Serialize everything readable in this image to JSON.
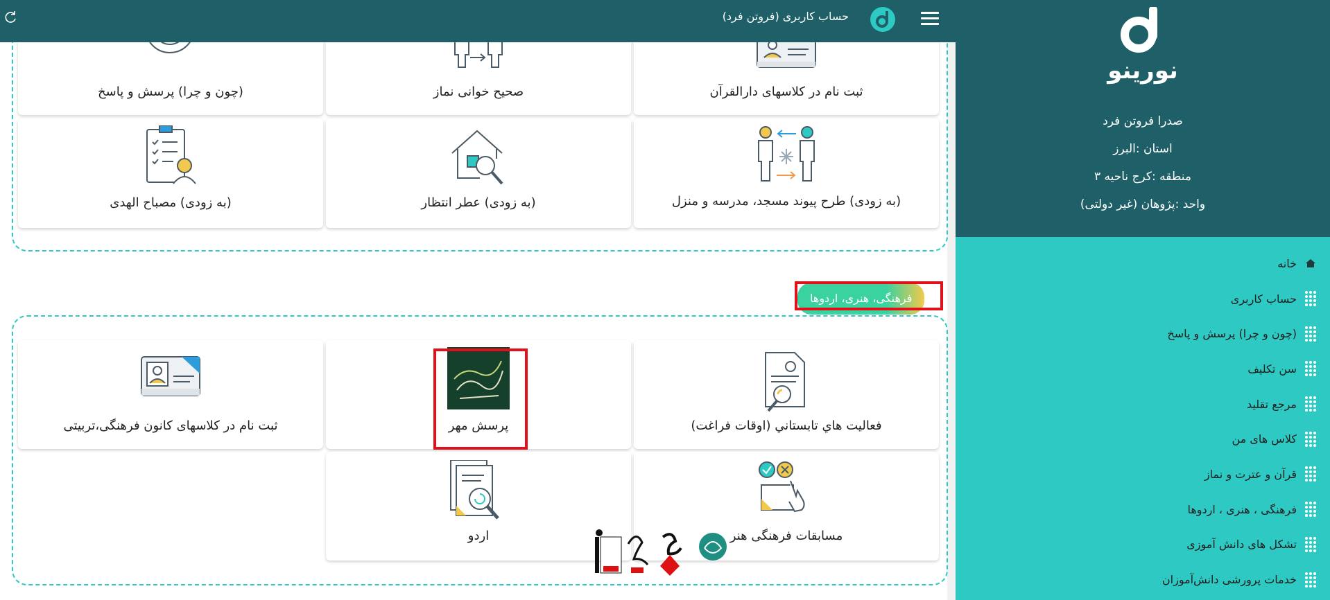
{
  "header": {
    "title": "حساب کاربری (فروتن فرد)"
  },
  "sidebar": {
    "logo_text": "نورینو",
    "profile": {
      "name": "صدرا فروتن فرد",
      "province": "استان :البرز",
      "region": "منطقه :کرج ناحیه ۳",
      "unit": "واحد :پژوهان (غیر دولتی)"
    },
    "items": [
      {
        "label": "خانه",
        "icon": "home-icon"
      },
      {
        "label": "حساب کاربری",
        "icon": "grip-icon"
      },
      {
        "label": "(چون و چرا) پرسش و پاسخ",
        "icon": "grip-icon"
      },
      {
        "label": "سن تکلیف",
        "icon": "grip-icon"
      },
      {
        "label": "مرجع تقلید",
        "icon": "grip-icon"
      },
      {
        "label": "کلاس های من",
        "icon": "grip-icon"
      },
      {
        "label": "قرآن و عترت و نماز",
        "icon": "grip-icon"
      },
      {
        "label": "فرهنگی ، هنری ، اردوها",
        "icon": "grip-icon"
      },
      {
        "label": "تشکل های دانش آموزی",
        "icon": "grip-icon"
      },
      {
        "label": "خدمات پرورشی دانش‌آموزان",
        "icon": "grip-icon"
      }
    ]
  },
  "section1": {
    "cards": [
      {
        "title": "ثبت نام در کلاسهای دارالقرآن",
        "icon": "id-card-icon"
      },
      {
        "title": "صحیح خوانی نماز",
        "icon": "prayer-people-icon"
      },
      {
        "title": "(چون و چرا) پرسش و پاسخ",
        "icon": "target-icon"
      },
      {
        "title": "(به زودی) طرح پیوند مسجد، مدرسه و منزل",
        "icon": "exchange-people-icon"
      },
      {
        "title": "(به زودی) عطر انتظار",
        "icon": "house-search-icon"
      },
      {
        "title": "(به زودی) مصباح الهدی",
        "icon": "checklist-person-icon"
      }
    ]
  },
  "section2": {
    "label": "فرهنگی، هنری، اردوها",
    "cards": [
      {
        "title": "فعاليت هاي تابستاني (اوقات فراغت)",
        "icon": "certificate-search-icon"
      },
      {
        "title": "پرسش مهر",
        "icon": "porsesh-mehr-logo",
        "logo_text": "پرسش مهر"
      },
      {
        "title": "ثبت نام در کلاسهای کانون فرهنگی،تربیتی",
        "icon": "id-card-icon"
      },
      {
        "title": "مسابقات فرهنگی هنر",
        "icon": "quiz-hand-icon"
      },
      {
        "title": "اردو",
        "icon": "document-search-icon"
      }
    ]
  },
  "colors": {
    "header_bg": "#1e5f68",
    "sidebar_menu_bg": "#2ec9c2",
    "highlight_red": "#e0111b",
    "accent_green": "#3ad29f",
    "accent_yellow": "#f2c94c"
  }
}
